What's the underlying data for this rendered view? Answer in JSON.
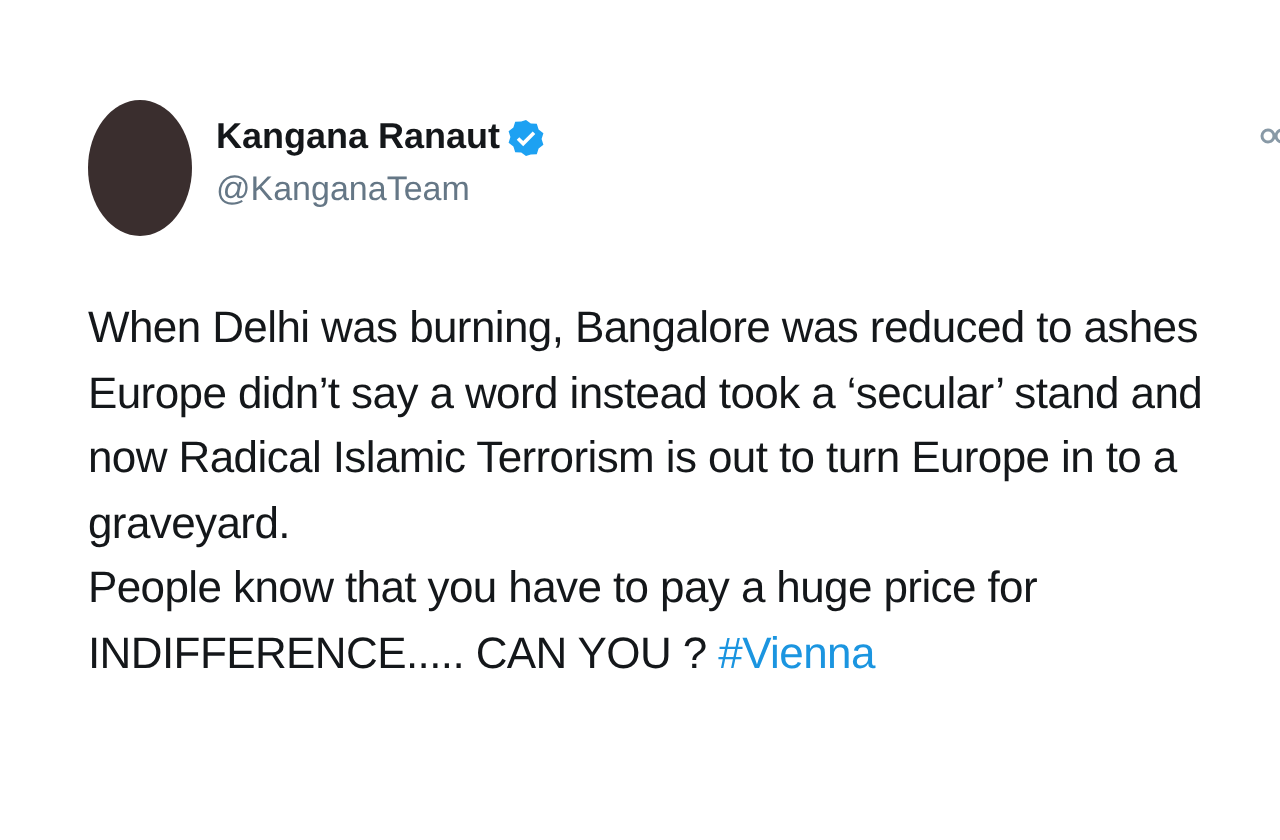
{
  "author": {
    "name": "Kangana Ranaut",
    "verified": true,
    "handle": "@KanganaTeam"
  },
  "paragraphs": [
    {
      "text": "When Delhi was burning, Bangalore was reduced to ashes Europe didn’t say a word instead took a ‘secular’ stand and now Radical Islamic Terrorism is out to turn Europe in to a graveyard."
    },
    {
      "text": "People know that you have to pay a huge price for INDIFFERENCE..... CAN YOU ?",
      "hashtag": "#Vienna"
    }
  ]
}
